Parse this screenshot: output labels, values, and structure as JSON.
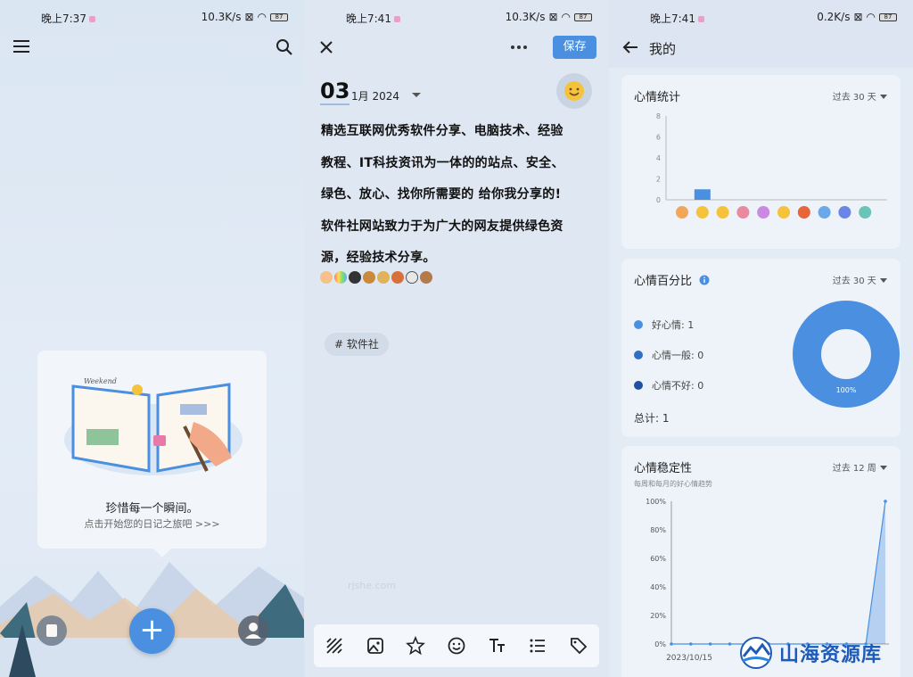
{
  "panel1": {
    "status": {
      "time": "晚上7:37",
      "speed": "10.3K/s",
      "battery": "87"
    },
    "empty": {
      "title": "珍惜每一个瞬间。",
      "subtitle": "点击开始您的日记之旅吧 >>>"
    },
    "fab_label": "+",
    "book_text": "Weekend"
  },
  "panel2": {
    "status": {
      "time": "晚上7:41",
      "speed": "10.3K/s",
      "battery": "87"
    },
    "save_label": "保存",
    "date": {
      "day": "03",
      "month_year": "1月  2024"
    },
    "body_lines": [
      "精选互联网优秀软件分享、电脑技术、经验",
      "教程、IT科技资讯为一体的的站点、安全、",
      "绿色、放心、找你所需要的 给你我分享的!",
      "软件社网站致力于为广大的网友提供绿色资",
      "源，经验技术分享。"
    ],
    "tag": "# 软件社",
    "watermark": "rjshe.com"
  },
  "panel3": {
    "status": {
      "time": "晚上7:41",
      "speed": "0.2K/s",
      "battery": "87"
    },
    "title": "我的",
    "stats_card": {
      "title": "心情统计",
      "range": "过去 30 天"
    },
    "percent_card": {
      "title": "心情百分比",
      "range": "过去 30 天",
      "legend": [
        {
          "label": "好心情: 1",
          "color": "#4a8fe0"
        },
        {
          "label": "心情一般: 0",
          "color": "#2f6fc4"
        },
        {
          "label": "心情不好: 0",
          "color": "#1e52a0"
        }
      ],
      "total": "总计: 1",
      "donut_label": "100%"
    },
    "stability_card": {
      "title": "心情稳定性",
      "range": "过去 12 周",
      "subtitle": "每周和每月的好心情趋势"
    },
    "brand": "山海资源库"
  },
  "chart_data": [
    {
      "type": "bar",
      "categories": [
        "😀",
        "😊",
        "😆",
        "😍",
        "😄",
        "😐",
        "😠",
        "😟",
        "😞",
        "😢"
      ],
      "values": [
        0,
        1,
        0,
        0,
        0,
        0,
        0,
        0,
        0,
        0
      ],
      "yticks": [
        0,
        2,
        4,
        6,
        8
      ],
      "ylim": [
        0,
        8
      ],
      "title": "心情统计",
      "color": "#4a8fe0"
    },
    {
      "type": "pie",
      "labels": [
        "好心情",
        "心情一般",
        "心情不好"
      ],
      "values": [
        1,
        0,
        0
      ],
      "center_label": "100%",
      "color": "#4a8fe0"
    },
    {
      "type": "area",
      "x_tick_label": "2023/10/15",
      "values": [
        0,
        0,
        0,
        0,
        0,
        0,
        0,
        0,
        0,
        0,
        0,
        100
      ],
      "yticks": [
        "0%",
        "20%",
        "40%",
        "60%",
        "80%",
        "100%"
      ],
      "ylim": [
        0,
        100
      ],
      "title": "心情稳定性",
      "color": "#4a8fe0"
    }
  ]
}
